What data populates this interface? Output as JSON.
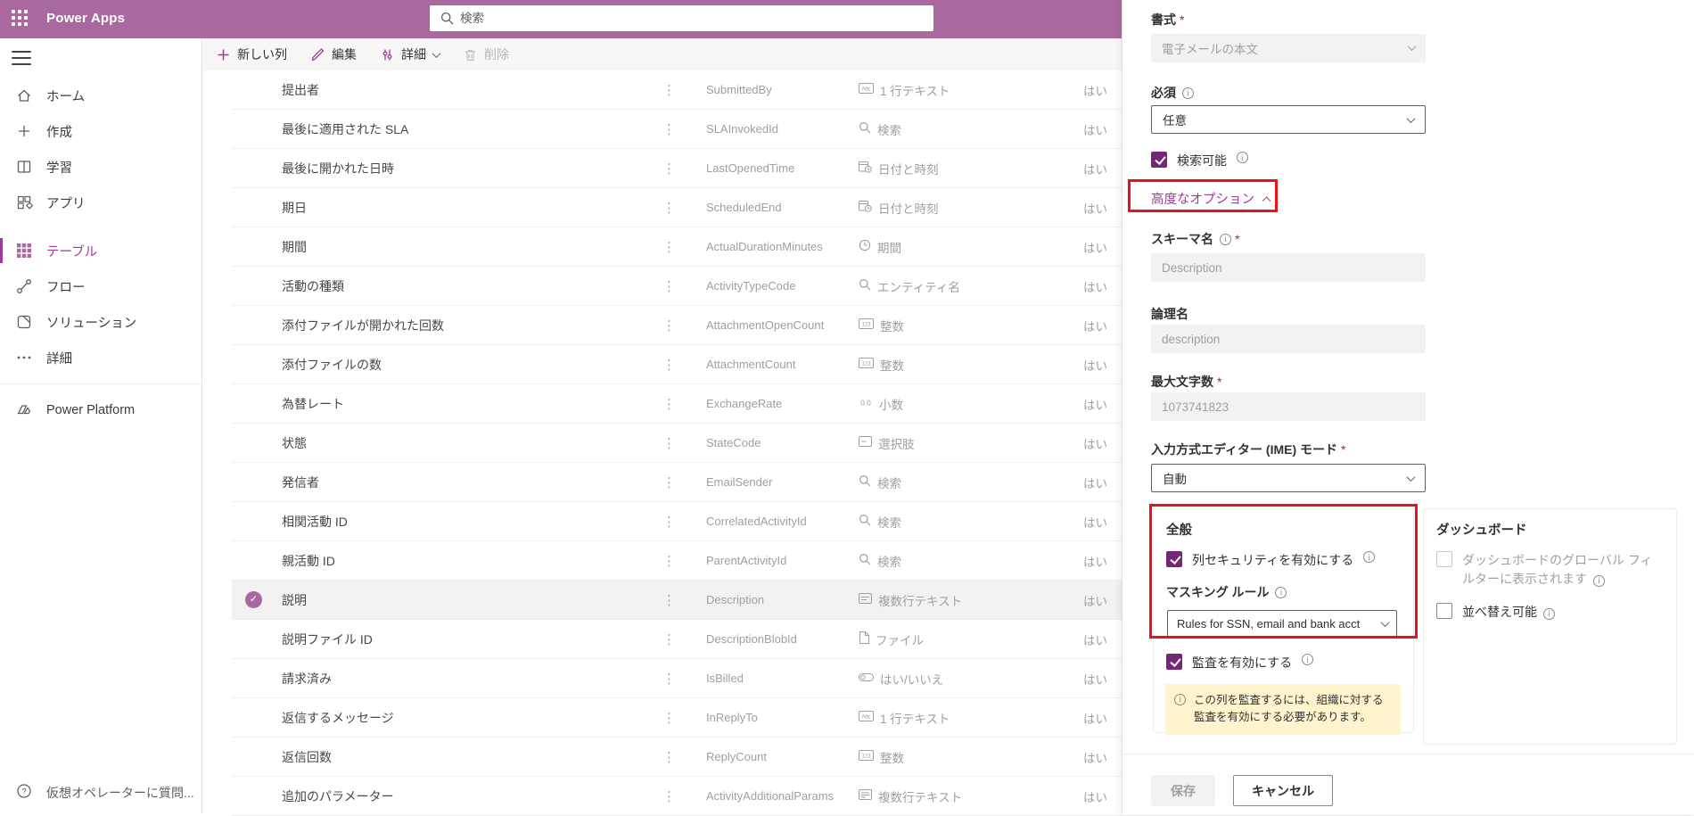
{
  "colors": {
    "header_purple": "#a9699e",
    "accent_purple": "#742774",
    "link_purple": "#9b3c9b",
    "annotation_red": "#e8121d",
    "note_yellow": "#fff4ce",
    "disabled_bg": "#f3f2f1"
  },
  "header": {
    "app_title": "Power Apps",
    "search_placeholder": "検索"
  },
  "sidebar": {
    "items": [
      {
        "label": "ホーム",
        "icon": "home"
      },
      {
        "label": "作成",
        "icon": "create"
      },
      {
        "label": "学習",
        "icon": "learn"
      },
      {
        "label": "アプリ",
        "icon": "apps"
      },
      {
        "label": "テーブル",
        "icon": "tables",
        "selected": true
      },
      {
        "label": "フロー",
        "icon": "flows"
      },
      {
        "label": "ソリューション",
        "icon": "solutions"
      },
      {
        "label": "詳細",
        "icon": "more"
      }
    ],
    "footer_item": {
      "label": "Power Platform",
      "icon": "power-platform"
    },
    "help": {
      "label": "仮想オペレーターに質問...",
      "icon": "help"
    }
  },
  "toolbar": {
    "new_column": "新しい列",
    "edit": "編集",
    "advanced": "詳細",
    "delete": "削除"
  },
  "table": {
    "rows": [
      {
        "display": "提出者",
        "schema": "SubmittedBy",
        "type": "1 行テキスト",
        "icon": "abc",
        "searchable": "はい"
      },
      {
        "display": "最後に適用された SLA",
        "schema": "SLAInvokedId",
        "type": "検索",
        "icon": "search",
        "searchable": "はい"
      },
      {
        "display": "最後に開かれた日時",
        "schema": "LastOpenedTime",
        "type": "日付と時刻",
        "icon": "datetime",
        "searchable": "はい"
      },
      {
        "display": "期日",
        "schema": "ScheduledEnd",
        "type": "日付と時刻",
        "icon": "datetime",
        "searchable": "はい"
      },
      {
        "display": "期間",
        "schema": "ActualDurationMinutes",
        "type": "期間",
        "icon": "clock",
        "searchable": "はい"
      },
      {
        "display": "活動の種類",
        "schema": "ActivityTypeCode",
        "type": "エンティティ名",
        "icon": "search",
        "searchable": "はい"
      },
      {
        "display": "添付ファイルが開かれた回数",
        "schema": "AttachmentOpenCount",
        "type": "整数",
        "icon": "num",
        "searchable": "はい"
      },
      {
        "display": "添付ファイルの数",
        "schema": "AttachmentCount",
        "type": "整数",
        "icon": "num",
        "searchable": "はい"
      },
      {
        "display": "為替レート",
        "schema": "ExchangeRate",
        "type": "小数",
        "icon": "dec",
        "searchable": "はい"
      },
      {
        "display": "状態",
        "schema": "StateCode",
        "type": "選択肢",
        "icon": "choice",
        "searchable": "はい"
      },
      {
        "display": "発信者",
        "schema": "EmailSender",
        "type": "検索",
        "icon": "search",
        "searchable": "はい"
      },
      {
        "display": "相関活動 ID",
        "schema": "CorrelatedActivityId",
        "type": "検索",
        "icon": "search",
        "searchable": "はい"
      },
      {
        "display": "親活動 ID",
        "schema": "ParentActivityId",
        "type": "検索",
        "icon": "search",
        "searchable": "はい"
      },
      {
        "display": "説明",
        "schema": "Description",
        "type": "複数行テキスト",
        "icon": "multiline",
        "searchable": "はい",
        "selected": true
      },
      {
        "display": "説明ファイル ID",
        "schema": "DescriptionBlobId",
        "type": "ファイル",
        "icon": "file",
        "searchable": "はい"
      },
      {
        "display": "請求済み",
        "schema": "IsBilled",
        "type": "はい/いいえ",
        "icon": "toggle",
        "searchable": "はい"
      },
      {
        "display": "返信するメッセージ",
        "schema": "InReplyTo",
        "type": "1 行テキスト",
        "icon": "abc",
        "searchable": "はい"
      },
      {
        "display": "返信回数",
        "schema": "ReplyCount",
        "type": "整数",
        "icon": "num",
        "searchable": "はい"
      },
      {
        "display": "追加のパラメーター",
        "schema": "ActivityAdditionalParams",
        "type": "複数行テキスト",
        "icon": "multirich",
        "searchable": "はい"
      }
    ]
  },
  "panel": {
    "format": {
      "label": "書式",
      "value": "電子メールの本文"
    },
    "required_field": {
      "label": "必須",
      "value": "任意"
    },
    "searchable": {
      "label": "検索可能",
      "checked": true
    },
    "advanced_options": {
      "label": "高度なオプション"
    },
    "schema_name": {
      "label": "スキーマ名",
      "value": "Description"
    },
    "logical_name": {
      "label": "論理名",
      "value": "description"
    },
    "max_length": {
      "label": "最大文字数",
      "value": "1073741823"
    },
    "ime_mode": {
      "label": "入力方式エディター (IME) モード",
      "value": "自動"
    },
    "general": {
      "title": "全般",
      "column_security": {
        "label": "列セキュリティを有効にする",
        "checked": true
      },
      "masking_rule": {
        "label": "マスキング ルール",
        "value": "Rules for SSN, email and bank acct"
      },
      "audit": {
        "label": "監査を有効にする",
        "checked": true
      },
      "audit_note": "この列を監査するには、組織に対する監査を有効にする必要があります。"
    },
    "dashboard": {
      "title": "ダッシュボード",
      "global_filter": {
        "label": "ダッシュボードのグローバル フィルターに表示されます",
        "checked": false,
        "disabled": true
      },
      "sortable": {
        "label": "並べ替え可能",
        "checked": false
      }
    },
    "footer": {
      "save_label": "保存",
      "cancel_label": "キャンセル"
    }
  }
}
